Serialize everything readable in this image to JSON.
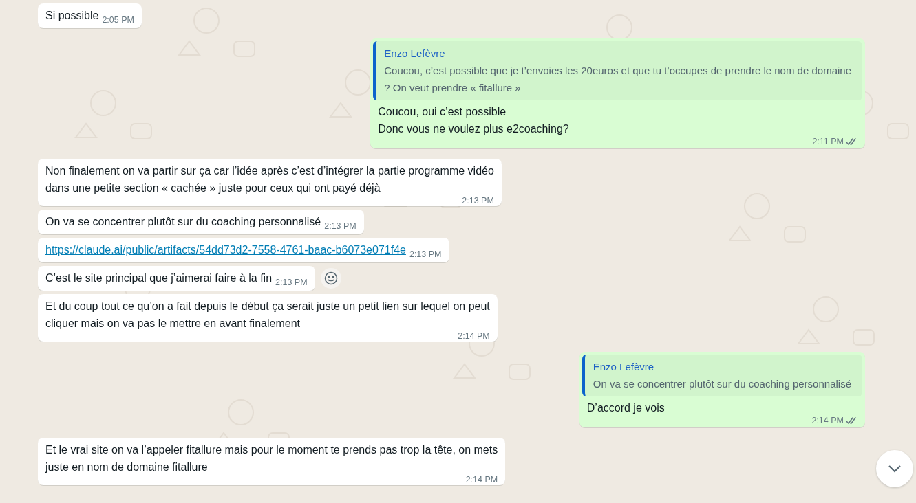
{
  "messages": [
    {
      "outgoing": false,
      "lines": [
        "Si possible"
      ],
      "time": "2:05 PM"
    },
    {
      "outgoing": true,
      "quote": {
        "author": "Enzo Lefèvre",
        "lines": [
          "Coucou, c’est possible que je t’envoies les 20euros et que tu t’occupes de prendre le nom de domaine",
          "? On veut prendre « fitallure »"
        ]
      },
      "lines": [
        "Coucou, oui c’est possible",
        "Donc vous ne voulez plus e2coaching?"
      ],
      "time": "2:11 PM",
      "read": false
    },
    {
      "outgoing": false,
      "lines": [
        "Non finalement on va partir sur ça car l’idée après c’est d’intégrer la partie programme vidéo",
        "dans une petite section « cachée » juste pour ceux qui ont payé déjà"
      ],
      "time": "2:13 PM"
    },
    {
      "outgoing": false,
      "lines": [
        "On va se concentrer plutôt sur du coaching personnalisé"
      ],
      "time": "2:13 PM"
    },
    {
      "outgoing": false,
      "kind": "link",
      "lines": [
        "https://claude.ai/public/artifacts/54dd73d2-7558-4761-baac-b6073e071f4e"
      ],
      "time": "2:13 PM"
    },
    {
      "outgoing": false,
      "lines": [
        "C’est le site principal que j’aimerai faire à la fin"
      ],
      "time": "2:13 PM",
      "reaction_button": true
    },
    {
      "outgoing": false,
      "lines": [
        "Et du coup tout ce qu’on a fait depuis le début ça serait juste un petit lien sur lequel on peut",
        "cliquer mais on va pas le mettre en avant finalement"
      ],
      "time": "2:14 PM"
    },
    {
      "outgoing": true,
      "quote": {
        "author": "Enzo Lefèvre",
        "lines": [
          "On va se concentrer plutôt sur du coaching personnalisé"
        ]
      },
      "lines": [
        "D’accord je vois"
      ],
      "time": "2:14 PM",
      "read": false
    },
    {
      "outgoing": false,
      "lines": [
        "Et le vrai site on va l’appeler fitallure mais pour le moment te prends pas trop la tête, on mets",
        "juste en nom de domaine fitallure"
      ],
      "time": "2:14 PM"
    }
  ]
}
